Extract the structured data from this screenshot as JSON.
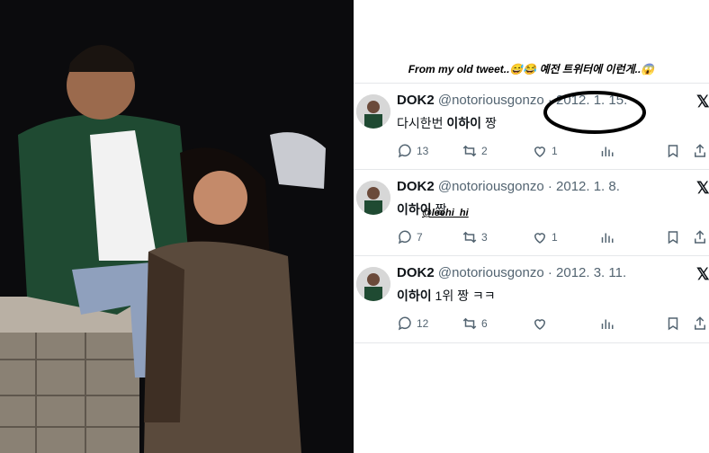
{
  "caption": "From my old tweet..😅😂 예전 트위터에 이런게..😱",
  "tweets": [
    {
      "name": "DOK2",
      "handle": "@notoriousgonzo",
      "sep": " · ",
      "date": "2012. 1. 15.",
      "text_prefix": "다시한번 ",
      "text_bold": "이하이",
      "text_suffix": " 짱",
      "replies": "13",
      "retweets": "2",
      "likes": "1"
    },
    {
      "name": "DOK2",
      "handle": "@notoriousgonzo",
      "sep": " · ",
      "date": "2012. 1. 8.",
      "text_prefix": "",
      "text_bold": "이하이",
      "text_suffix": " 짱",
      "replies": "7",
      "retweets": "3",
      "likes": "1",
      "tag": "@leehi_hi"
    },
    {
      "name": "DOK2",
      "handle": "@notoriousgonzo",
      "sep": " · ",
      "date": "2012. 3. 11.",
      "text_prefix": "",
      "text_bold": "이하이",
      "text_suffix": " 1위 짱 ㅋㅋ",
      "replies": "12",
      "retweets": "6",
      "likes": ""
    }
  ],
  "x_logo": "𝕏",
  "colors": {
    "accent": "#0f1419",
    "meta": "#536471",
    "photo_bg": "#0b0b0d",
    "jacket": "#1f4a32"
  },
  "icons": {
    "reply": "reply-icon",
    "retweet": "retweet-icon",
    "like": "heart-icon",
    "views": "bar-chart-icon",
    "bookmark": "bookmark-icon",
    "share": "share-icon"
  }
}
